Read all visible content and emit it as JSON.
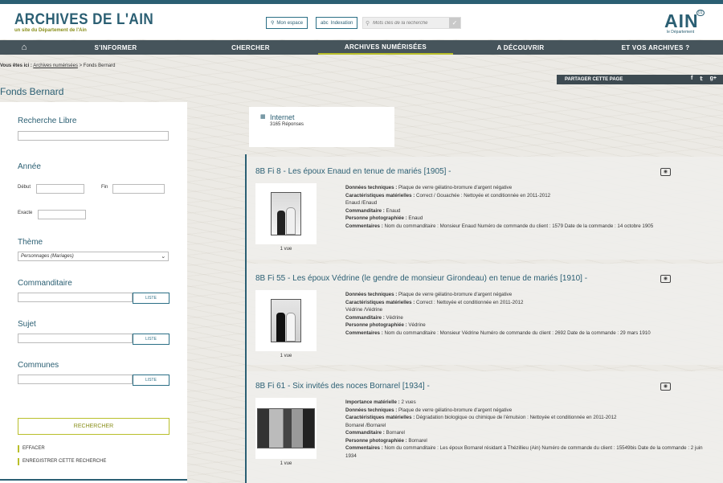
{
  "header": {
    "brand": "ARCHIVES DE L'AIN",
    "brand_sub": "un site du Département de l'Ain",
    "mon_espace": "Mon espace",
    "indexation": "Indexation",
    "search_placeholder": "Mots clés de la recherche",
    "logo": "AIN",
    "logo_sub": "le Département",
    "logo_num": "01"
  },
  "nav": {
    "items": [
      "S'INFORMER",
      "CHERCHER",
      "ARCHIVES NUMÉRISÉES",
      "A DÉCOUVRIR",
      "ET VOS ARCHIVES ?"
    ],
    "active": "ARCHIVES NUMÉRISÉES"
  },
  "breadcrumb": {
    "prefix": "Vous êtes ici :",
    "link": "Archives numérisées",
    "sep": " > ",
    "current": "Fonds Bernard"
  },
  "share": {
    "label": "PARTAGER CETTE PAGE"
  },
  "page_title": "Fonds Bernard",
  "sidebar": {
    "recherche_libre": "Recherche Libre",
    "annee": "Année",
    "debut": "Début",
    "fin": "Fin",
    "exacte": "Exacte",
    "theme": "Thème",
    "theme_value": "Personnages (Mariages)",
    "commanditaire": "Commanditaire",
    "sujet": "Sujet",
    "communes": "Communes",
    "liste": "LISTE",
    "rechercher": "RECHERCHER",
    "effacer": "EFFACER",
    "enregistrer": "ENREGISTRER CETTE RECHERCHE"
  },
  "count": {
    "label": "Internet",
    "value": "3165 Réponses"
  },
  "results": [
    {
      "title": "8B Fi 8 - Les époux Enaud en tenue de mariés [1905] -",
      "vue": "1 vue",
      "lines": [
        [
          "Données techniques : ",
          "Plaque de verre gélatino-bromure d'argent négative"
        ],
        [
          "Caractéristiques matérielles : ",
          "Correct / Gouachée : Nettoyée et conditionnée en 2011-2012"
        ],
        [
          "",
          "Enaud /Enaud"
        ],
        [
          "Commanditaire : ",
          "Enaud"
        ],
        [
          "Personne photographiée : ",
          "Enaud"
        ],
        [
          "Commentaires : ",
          "Nom du commanditaire : Monsieur Enaud Numéro de commande du client : 1579 Date de la commande : 14 octobre 1905"
        ]
      ]
    },
    {
      "title": "8B Fi 55 - Les époux Védrine (le gendre de monsieur Girondeau) en tenue de mariés [1910] -",
      "vue": "1 vue",
      "lines": [
        [
          "Données techniques : ",
          "Plaque de verre gélatino-bromure d'argent négative"
        ],
        [
          "Caractéristiques matérielles : ",
          "Correct : Nettoyée et conditionnée en 2011-2012"
        ],
        [
          "",
          "Védrine /Védrine"
        ],
        [
          "Commanditaire : ",
          "Védrine"
        ],
        [
          "Personne photographiée : ",
          "Védrine"
        ],
        [
          "Commentaires : ",
          "Nom du commanditaire : Monsieur Védrine Numéro de commande du client : 2692 Date de la commande : 29 mars 1910"
        ]
      ]
    },
    {
      "title": "8B Fi 61 - Six invités des noces Bornarel [1934] -",
      "vue": "1 vue",
      "lines": [
        [
          "Importance matérielle : ",
          "2 vues"
        ],
        [
          "Données techniques : ",
          "Plaque de verre gélatino-bromure d'argent négative"
        ],
        [
          "Caractéristiques matérielles : ",
          "Dégradation biologique ou chimique de l'émulsion : Nettoyée et conditionnée en 2011-2012"
        ],
        [
          "",
          "Bornarel /Bornarel"
        ],
        [
          "Commanditaire : ",
          "Bornarel"
        ],
        [
          "Personne photographiée : ",
          "Bornarel"
        ],
        [
          "Commentaires : ",
          "Nom du commanditaire : Les époux Bornarel résidant à Thézillieu (Ain) Numéro de commande du client : 15549bis Date de la commande : 2 juin 1934"
        ]
      ]
    }
  ],
  "colors": {
    "primary": "#2b5f73",
    "accent": "#b9bf2a",
    "nav_bg": "#46545b"
  },
  "icons": [
    "home-icon",
    "user-icon",
    "index-icon",
    "search-icon",
    "facebook-icon",
    "twitter-icon",
    "googleplus-icon",
    "grid-icon",
    "camera-icon"
  ]
}
